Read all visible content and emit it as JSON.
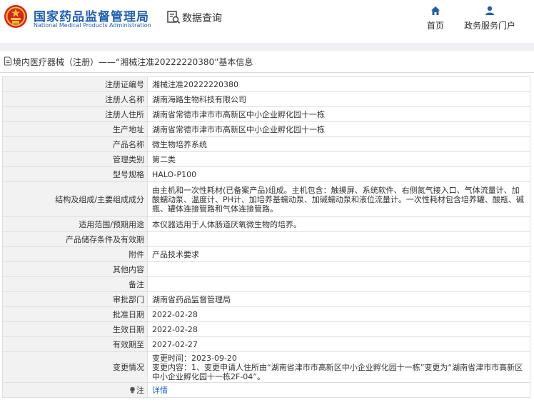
{
  "header": {
    "logo_cn": "国家药品监督管理局",
    "logo_en": "National Medical Products Administration",
    "query_label": "数据查询",
    "nav": {
      "home": "首页",
      "service": "政务服务门户"
    }
  },
  "breadcrumb": "境内医疗器械（注册）——“湘械注准20222220380”基本信息",
  "rows": [
    {
      "key": "注册证编号",
      "value": "湘械注准20222220380"
    },
    {
      "key": "注册人名称",
      "value": "湖南海路生物科技有限公司"
    },
    {
      "key": "注册人住所",
      "value": "湖南省常德市津市市高新区中小企业孵化园十一栋"
    },
    {
      "key": "生产地址",
      "value": "湖南省常德市津市市高新区中小企业孵化园十一栋"
    },
    {
      "key": "产品名称",
      "value": "微生物培养系统"
    },
    {
      "key": "管理类别",
      "value": "第二类"
    },
    {
      "key": "型号规格",
      "value": "HALO-P100"
    },
    {
      "key": "结构及组成/主要组成成分",
      "value": "由主机和一次性耗材(已备案产品)组成。主机包含：触摸屏、系统软件、右侧氮气接入口、气体流量计、加酸蠕动泵、温度计、PH计、加培养基蠕动泵、加碱蠕动泵和液位流量计。一次性耗材包含培养罐、酸瓶、碱瓶、罐体连接管路和气体连接管路。"
    },
    {
      "key": "适用范围/预期用途",
      "value": "本仪器适用于人体肠道厌氧微生物的培养。"
    },
    {
      "key": "产品储存条件及有效期",
      "value": ""
    },
    {
      "key": "附件",
      "value": "产品技术要求"
    },
    {
      "key": "其他内容",
      "value": ""
    },
    {
      "key": "备注",
      "value": ""
    },
    {
      "key": "审批部门",
      "value": "湖南省药品监督管理局"
    },
    {
      "key": "批准日期",
      "value": "2022-02-28"
    },
    {
      "key": "生效日期",
      "value": "2022-02-28"
    },
    {
      "key": "有效期至",
      "value": "2027-02-27"
    },
    {
      "key": "变更情况",
      "value": "变更时间：2023-09-20\n变更内容：1、变更申请人住所由“湖南省津市市高新区中小企业孵化园十一栋”变更为“湖南省津市市高新区中小企业孵化园十一栋2F-04”。"
    },
    {
      "key": "注",
      "value": "详情"
    }
  ],
  "colors": {
    "brand_blue": "#1f5fb0",
    "link_blue": "#1f63c6",
    "emblem_red": "#d7231f",
    "emblem_gold": "#f2c230"
  },
  "icons": {
    "emblem": "national-emblem-icon",
    "query": "data-query-icon",
    "home": "home-icon",
    "service": "user-icon",
    "crumb": "document-icon",
    "note": "lightbulb-icon"
  }
}
